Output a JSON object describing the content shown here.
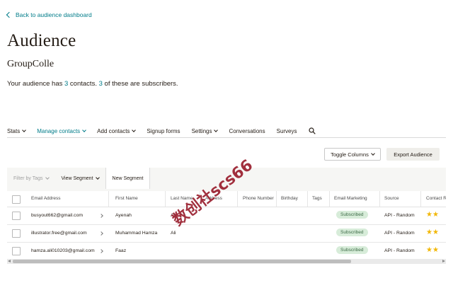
{
  "back_link": "Back to audience dashboard",
  "title": "Audience",
  "audience_name": "GroupColle",
  "summary": {
    "prefix": "Your audience has ",
    "contacts": "3",
    "middle": " contacts. ",
    "subscribers": "3",
    "suffix": " of these are subscribers."
  },
  "nav": {
    "stats": "Stats",
    "manage_contacts": "Manage contacts",
    "add_contacts": "Add contacts",
    "signup_forms": "Signup forms",
    "settings": "Settings",
    "conversations": "Conversations",
    "surveys": "Surveys",
    "search_icon": "search-icon"
  },
  "buttons": {
    "toggle_columns": "Toggle Columns",
    "export_audience": "Export Audience"
  },
  "toolbar": {
    "filter_by_tags": "Filter by Tags",
    "view_segment": "View Segment",
    "new_segment": "New Segment"
  },
  "columns": {
    "email": "Email Address",
    "first_name": "First Name",
    "last_name": "Last Name",
    "address": "Address",
    "phone": "Phone Number",
    "birthday": "Birthday",
    "tags": "Tags",
    "email_marketing": "Email Marketing",
    "source": "Source",
    "contact_rating": "Contact Rating"
  },
  "rows": [
    {
      "email": "busyout662@gmail.com",
      "first_name": "Ayenah",
      "last_name": "Ali",
      "status": "Subscribed",
      "source": "API - Random",
      "rating": 2
    },
    {
      "email": "illustrator.free@gmail.com",
      "first_name": "Muhammad Hamza",
      "last_name": "Ali",
      "status": "Subscribed",
      "source": "API - Random",
      "rating": 2
    },
    {
      "email": "hamza.ali010203@gmail.com",
      "first_name": "Faaz",
      "last_name": "",
      "status": "Subscribed",
      "source": "API - Random",
      "rating": 2
    }
  ],
  "watermark": "数创社scs66",
  "colors": {
    "accent": "#007c89",
    "badge_bg": "#d7ecd9",
    "badge_text": "#3d6b46",
    "star": "#f2b705"
  }
}
